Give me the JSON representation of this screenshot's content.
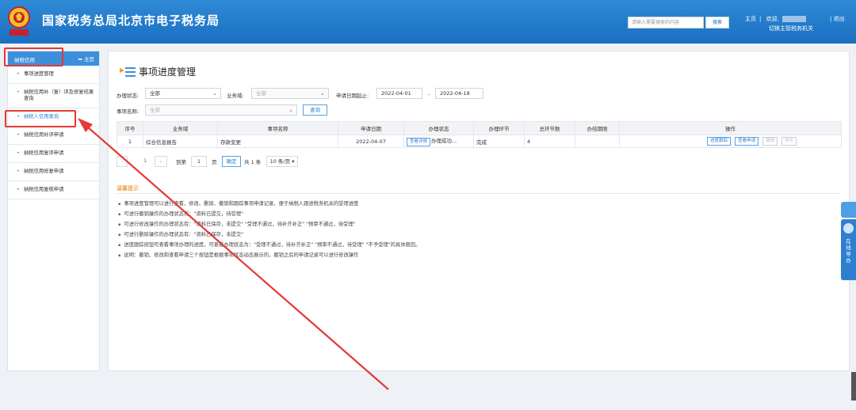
{
  "header": {
    "site_title": "国家税务总局北京市电子税务局",
    "search_placeholder": "请输入需要搜索的内容",
    "search_button": "搜索",
    "nav_home": "主页",
    "nav_welcome": "欢迎,",
    "nav_logout": "退出",
    "nav_switch": "切换主管税务机关",
    "emblem_icon": "tax-emblem-icon"
  },
  "sidebar": {
    "title": "纳税信用",
    "home_label": "主页",
    "items": [
      {
        "label": "事项进度管理"
      },
      {
        "label": "纳税信用补（复）评及修复结果查询"
      },
      {
        "label": "纳税人信用查询"
      },
      {
        "label": "纳税信用补评申请"
      },
      {
        "label": "纳税信用复评申请"
      },
      {
        "label": "纳税信用修复申请"
      },
      {
        "label": "纳税信用复核申请"
      }
    ]
  },
  "main": {
    "title": "事项进度管理",
    "form": {
      "status_label": "办理状态:",
      "status_value": "全部",
      "domain_label": "业务域:",
      "domain_value": "全部",
      "date_label": "申请日期起止:",
      "date_from": "2022-04-01",
      "date_sep": "-",
      "date_to": "2022-04-18",
      "name_label": "事项名称:",
      "name_value": "全部",
      "query_button": "查询"
    },
    "table": {
      "headers": [
        "序号",
        "业务域",
        "事项名称",
        "申请日期",
        "办理状态",
        "办理环节",
        "总环节数",
        "办结期限",
        "操作"
      ],
      "rows": [
        {
          "index": "1",
          "domain": "综合信息报告",
          "name": "存款变更",
          "date": "2022-04-07",
          "status_btn": "查看详情",
          "status_text": "办理成功...",
          "stage": "完成",
          "total": "4",
          "deadline": "",
          "actions": [
            "进度跟踪",
            "查看申请",
            "撤销",
            "评价"
          ]
        }
      ]
    },
    "pager": {
      "current": "1",
      "goto_label": "到第",
      "goto_value": "1",
      "page_unit": "页",
      "confirm": "确定",
      "total": "共 1 条",
      "page_size": "10 条/页"
    },
    "tips": {
      "title": "温馨提示",
      "lines": [
        "事项进度管理可以进行查看、修改、删除、撤销和跟踪事项申请记录，便于纳税人跟进税务机关的受理进度",
        "可进行撤销操作的办理状态有：\"资料已提交，待受理\"",
        "可进行修改操作的办理状态有：\"资料已保存，未提交\" \"受理不通过，待补齐补正\" \"预审不通过，待受理\"",
        "可进行删除操作的办理状态有：\"资料已保存，未提交\"",
        "进度跟踪按钮可查看事项办理的进度，可查看办理状态为：\"受理不通过，待补齐补正\" \"预审不通过，待受理\" \"不予受理\"的具体原因。",
        "说明：撤销、修改和查看申请三个按钮是根据事项状态动态展示的，撤销之后的申请记录可以进行修改操作"
      ]
    }
  },
  "float": {
    "guide_chars": [
      "在",
      "线",
      "导",
      "办"
    ]
  },
  "colors": {
    "header": "#1a6fc1",
    "accent": "#2b7fd4",
    "annotation": "#e53935",
    "tips_title": "#e07b00"
  }
}
